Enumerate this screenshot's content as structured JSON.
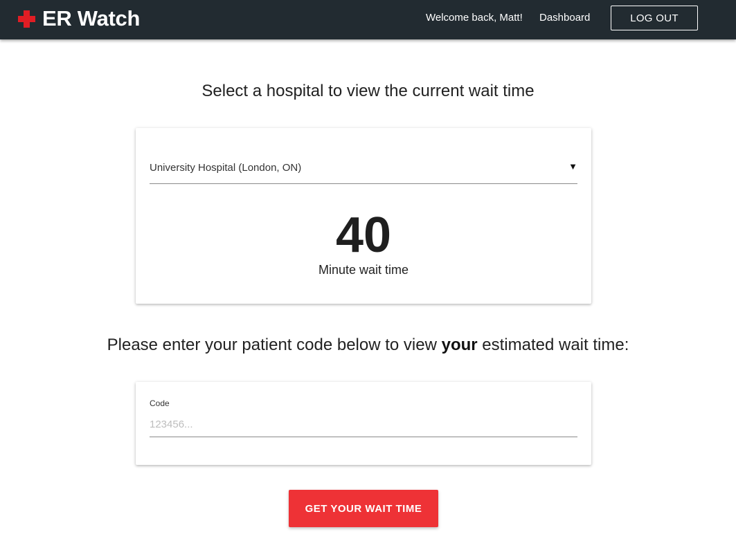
{
  "navbar": {
    "brand": "ER Watch",
    "welcome": "Welcome back, Matt!",
    "dashboard_link": "Dashboard",
    "logout_label": "LOG OUT"
  },
  "hospital_section": {
    "heading": "Select a hospital to view the current wait time",
    "selected_hospital": "University Hospital (London, ON)",
    "wait_minutes": "40",
    "wait_label": "Minute wait time"
  },
  "code_section": {
    "heading_before": "Please enter your patient code below to view",
    "heading_bold": "your",
    "heading_after": "estimated wait time:",
    "field_label": "Code",
    "placeholder": "123456...",
    "value": "",
    "submit_label": "GET YOUR WAIT TIME"
  },
  "colors": {
    "navbar_bg": "#222b31",
    "brand_cross": "#e11d24",
    "primary_button": "#ee3236"
  },
  "icons": {
    "brand": "red-cross-icon",
    "select": "dropdown-arrow-icon"
  }
}
